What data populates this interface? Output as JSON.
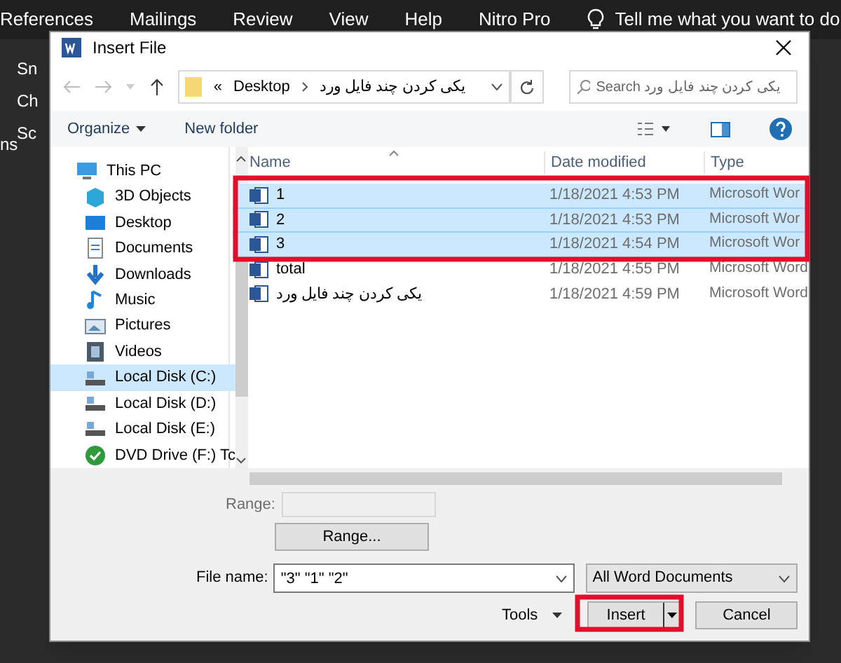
{
  "app_menu": [
    "References",
    "Mailings",
    "Review",
    "View",
    "Help",
    "Nitro Pro"
  ],
  "tell_me": "Tell me what you want to do",
  "ribbon_fragments": [
    "Sn",
    "Ch",
    "Sc",
    "ns"
  ],
  "window": {
    "title": "Insert File"
  },
  "address": {
    "overflow": "«",
    "path": [
      "Desktop",
      "یکی کردن چند فایل ورد"
    ]
  },
  "search": {
    "placeholder": "Search یکی کردن چند فایل ورد"
  },
  "toolbar": [
    "Organize",
    "New folder"
  ],
  "sidebar": {
    "items": [
      {
        "label": "This PC",
        "kind": "pc",
        "selected": false
      },
      {
        "label": "3D Objects",
        "kind": "cube",
        "selected": false
      },
      {
        "label": "Desktop",
        "kind": "desktop",
        "selected": false
      },
      {
        "label": "Documents",
        "kind": "doc",
        "selected": false
      },
      {
        "label": "Downloads",
        "kind": "download",
        "selected": false
      },
      {
        "label": "Music",
        "kind": "music",
        "selected": false
      },
      {
        "label": "Pictures",
        "kind": "pictures",
        "selected": false
      },
      {
        "label": "Videos",
        "kind": "video",
        "selected": false
      },
      {
        "label": "Local Disk (C:)",
        "kind": "disk",
        "selected": true
      },
      {
        "label": "Local Disk (D:)",
        "kind": "disk",
        "selected": false
      },
      {
        "label": "Local Disk (E:)",
        "kind": "disk",
        "selected": false
      },
      {
        "label": "DVD Drive (F:) Tc",
        "kind": "dvd",
        "selected": false
      }
    ]
  },
  "table": {
    "columns": [
      "Name",
      "Date modified",
      "Type"
    ],
    "rows": [
      {
        "name": "1",
        "date": "1/18/2021 4:53 PM",
        "type": "Microsoft Wor",
        "selected": true
      },
      {
        "name": "2",
        "date": "1/18/2021 4:53 PM",
        "type": "Microsoft Wor",
        "selected": true
      },
      {
        "name": "3",
        "date": "1/18/2021 4:54 PM",
        "type": "Microsoft Wor",
        "selected": true
      },
      {
        "name": "total",
        "date": "1/18/2021 4:55 PM",
        "type": "Microsoft Word",
        "selected": false
      },
      {
        "name": "یکی کردن چند فایل ورد",
        "date": "1/18/2021 4:59 PM",
        "type": "Microsoft Word",
        "selected": false
      }
    ]
  },
  "range": {
    "label": "Range:",
    "button": "Range..."
  },
  "file_name": {
    "label": "File name:",
    "value": "\"3\" \"1\" \"2\""
  },
  "file_type": "All Word Documents",
  "buttons": {
    "tools": "Tools",
    "insert": "Insert",
    "cancel": "Cancel"
  }
}
